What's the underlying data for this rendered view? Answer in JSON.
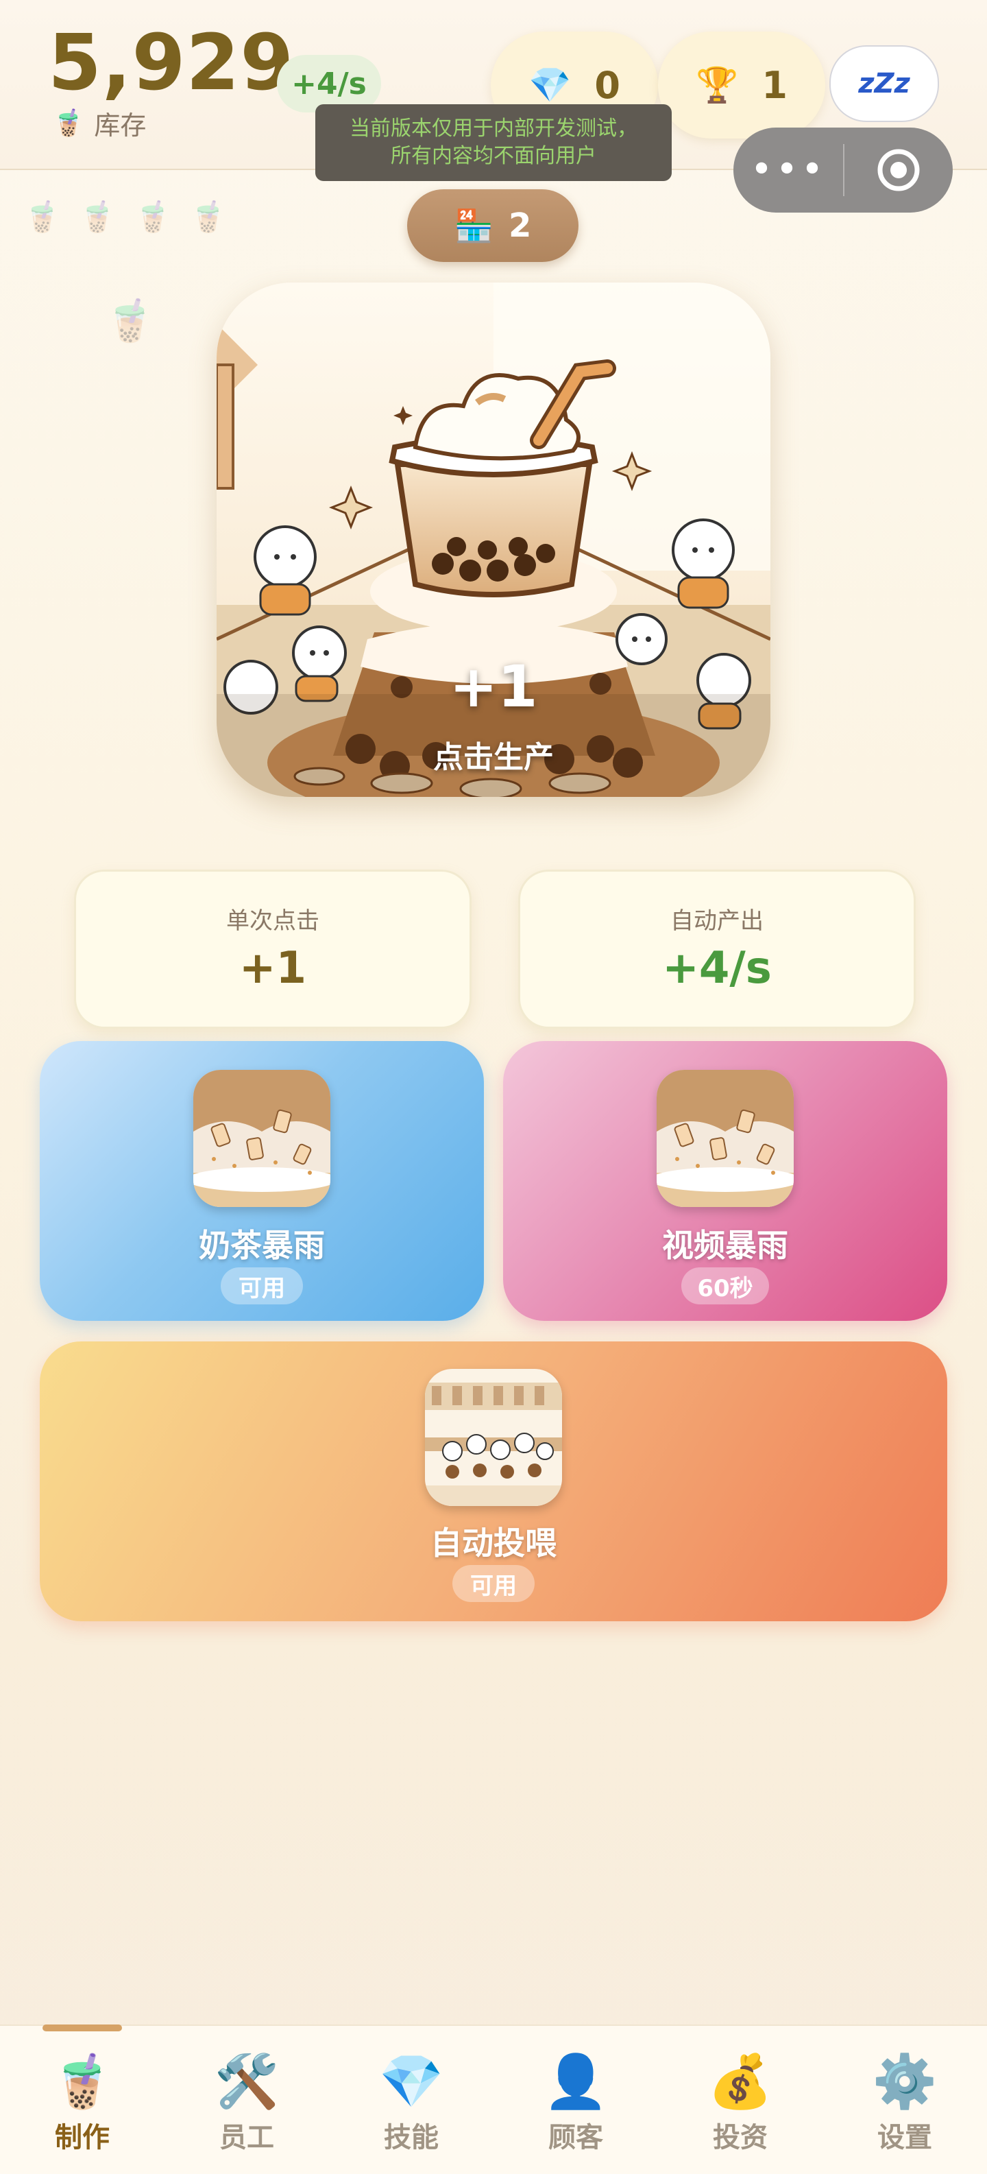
{
  "header": {
    "stock_value": "5,929",
    "stock_label": "库存",
    "rate": "+4/s",
    "gems": "0",
    "trophies": "1",
    "sleep_label": "zZz",
    "shop_level": "2"
  },
  "notice": {
    "line1": "当前版本仅用于内部开发测试，",
    "line2": "所有内容均不面向用户"
  },
  "main_art": {
    "plus": "+1",
    "cta": "点击生产"
  },
  "stats": {
    "click_label": "单次点击",
    "click_value": "+1",
    "auto_label": "自动产出",
    "auto_value": "+4/s"
  },
  "skills": [
    {
      "title": "奶茶暴雨",
      "status": "可用"
    },
    {
      "title": "视频暴雨",
      "status": "60秒"
    },
    {
      "title": "自动投喂",
      "status": "可用"
    }
  ],
  "nav": [
    {
      "label": "制作",
      "icon": "bubble-tea-icon",
      "active": true
    },
    {
      "label": "员工",
      "icon": "hammer-wrench-icon"
    },
    {
      "label": "技能",
      "icon": "gem-icon"
    },
    {
      "label": "顾客",
      "icon": "person-icon"
    },
    {
      "label": "投资",
      "icon": "money-bag-icon"
    },
    {
      "label": "设置",
      "icon": "gear-icon"
    }
  ],
  "colors": {
    "stock": "#7b6220",
    "rate_green": "#4a9a3e",
    "skill_blue": "#5fb2ea",
    "skill_pink": "#dc4f86",
    "skill_orange": "#ef7d55"
  }
}
